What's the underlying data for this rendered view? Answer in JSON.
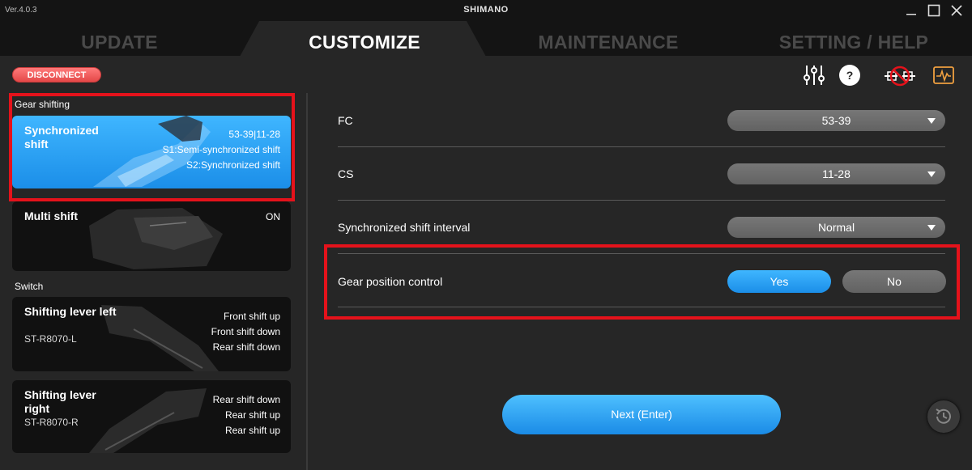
{
  "window": {
    "version": "Ver.4.0.3",
    "brand": "SHIMANO",
    "minimize_icon": "minimize-icon",
    "maximize_icon": "maximize-icon",
    "close_icon": "close-icon"
  },
  "nav": {
    "tabs": [
      {
        "label": "UPDATE",
        "active": false
      },
      {
        "label": "CUSTOMIZE",
        "active": true
      },
      {
        "label": "MAINTENANCE",
        "active": false
      },
      {
        "label": "SETTING / HELP",
        "active": false
      }
    ]
  },
  "toolbar": {
    "disconnect_label": "DISCONNECT",
    "icons": [
      "sliders-icon",
      "help-icon",
      "no-connection-icon",
      "monitor-icon"
    ]
  },
  "sidebar": {
    "sections": [
      {
        "label": "Gear shifting",
        "cards": [
          {
            "title": "Synchronized shift",
            "right": [
              "53-39|11-28",
              "S1:Semi-synchronized shift",
              "S2:Synchronized shift"
            ],
            "selected": true
          },
          {
            "title": "Multi shift",
            "right": [
              "ON"
            ],
            "selected": false
          }
        ]
      },
      {
        "label": "Switch",
        "cards": [
          {
            "title": "Shifting lever left",
            "sub": "ST-R8070-L",
            "right": [
              "Front shift up",
              "Front shift down",
              "Rear shift down"
            ],
            "selected": false
          },
          {
            "title": "Shifting lever right",
            "sub": "ST-R8070-R",
            "right": [
              "Rear shift down",
              "Rear shift up",
              "Rear shift up"
            ],
            "selected": false
          }
        ]
      }
    ]
  },
  "settings": {
    "fc": {
      "label": "FC",
      "value": "53-39"
    },
    "cs": {
      "label": "CS",
      "value": "11-28"
    },
    "interval": {
      "label": "Synchronized shift interval",
      "value": "Normal"
    },
    "gear_position": {
      "label": "Gear position control",
      "yes": "Yes",
      "no": "No",
      "selected": "Yes"
    }
  },
  "footer": {
    "next_label": "Next (Enter)"
  },
  "colors": {
    "accent_blue": "#1b8ee8",
    "highlight_red": "#e5121b",
    "disconnect_red": "#e44848"
  }
}
